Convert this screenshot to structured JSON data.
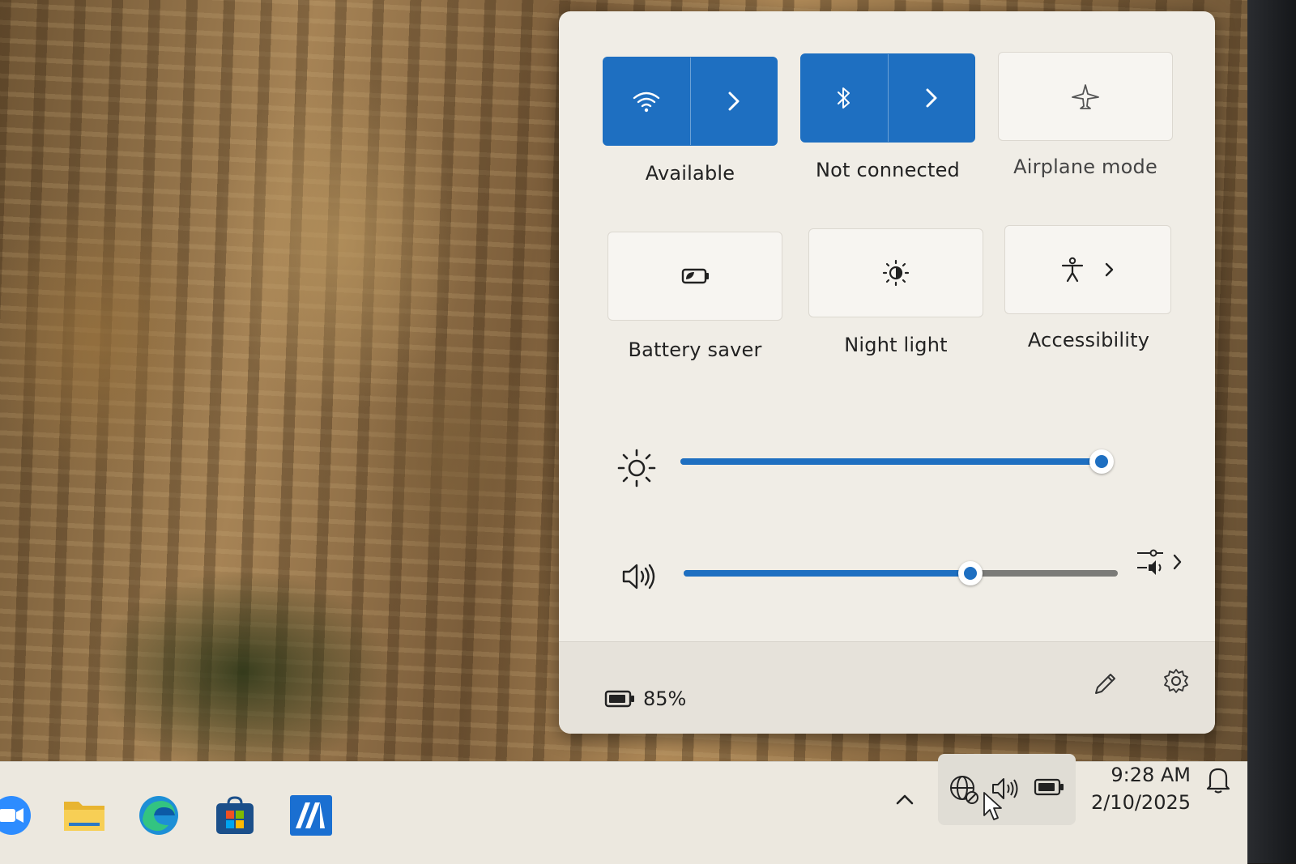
{
  "quick_settings": {
    "tiles": [
      {
        "label": "Available",
        "icon": "wifi-icon",
        "state": "on",
        "has_chevron": true
      },
      {
        "label": "Not connected",
        "icon": "bluetooth-icon",
        "state": "on",
        "has_chevron": true
      },
      {
        "label": "Airplane mode",
        "icon": "airplane-icon",
        "state": "off",
        "has_chevron": false
      },
      {
        "label": "Battery saver",
        "icon": "battery-saver-icon",
        "state": "off",
        "has_chevron": false
      },
      {
        "label": "Night light",
        "icon": "night-light-icon",
        "state": "off",
        "has_chevron": false
      },
      {
        "label": "Accessibility",
        "icon": "accessibility-icon",
        "state": "off",
        "has_chevron": true
      }
    ],
    "brightness": {
      "icon": "brightness-icon",
      "level": 1.0
    },
    "volume": {
      "icon": "speaker-icon",
      "level": 0.66,
      "mixer_icon": "audio-mixer-icon"
    },
    "footer": {
      "battery_icon": "battery-icon",
      "battery_percent": "85%",
      "edit_icon": "pencil-icon",
      "settings_icon": "gear-icon"
    }
  },
  "taskbar": {
    "pinned": [
      "zoom-icon",
      "file-explorer-icon",
      "edge-icon",
      "store-icon",
      "app-icon"
    ],
    "tray": {
      "overflow_icon": "chevron-up-icon",
      "network_icon": "globe-no-internet-icon",
      "volume_icon": "speaker-icon",
      "battery_icon": "battery-icon"
    },
    "clock": {
      "time": "9:28 AM",
      "date": "2/10/2025"
    },
    "notification_icon": "bell-icon"
  },
  "colors": {
    "accent": "#1e6fc1",
    "panel": "#f0ede6",
    "taskbar": "#ece8df"
  }
}
